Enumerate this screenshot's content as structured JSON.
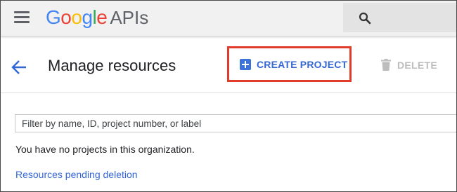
{
  "app": {
    "logo_letters": [
      {
        "char": "G",
        "color": "#4285f4"
      },
      {
        "char": "o",
        "color": "#ea4335"
      },
      {
        "char": "o",
        "color": "#fbbc05"
      },
      {
        "char": "g",
        "color": "#4285f4"
      },
      {
        "char": "l",
        "color": "#34a853"
      },
      {
        "char": "e",
        "color": "#ea4335"
      }
    ],
    "logo_suffix": "APIs",
    "menu_icon": "hamburger-menu-icon",
    "search_icon": "search-icon"
  },
  "header": {
    "title": "Manage resources",
    "back_icon": "arrow-left-icon",
    "create_label": "CREATE PROJECT",
    "create_icon": "add-box-icon",
    "delete_label": "DELETE",
    "delete_icon": "trash-icon",
    "highlight_color": "#e03b2b"
  },
  "content": {
    "filter_placeholder": "Filter by name, ID, project number, or label",
    "filter_value": "",
    "empty_message": "You have no projects in this organization.",
    "pending_link": "Resources pending deletion"
  },
  "colors": {
    "accent": "#3367d6",
    "disabled": "#bdbdbd",
    "appbar_bg": "#f1f1f1"
  }
}
